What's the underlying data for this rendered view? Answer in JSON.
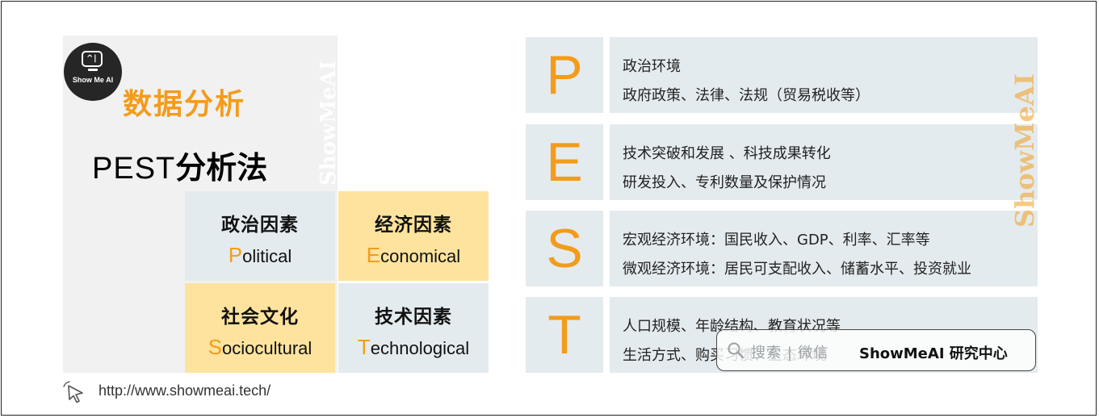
{
  "header": {
    "logo_text": "Show Me AI",
    "title": "数据分析",
    "subtitle_latin": "PEST",
    "subtitle_cn": "分析法"
  },
  "watermarks": {
    "left_vertical": "ShowMeAI",
    "right_vertical": "ShowMeAI"
  },
  "quadrants": [
    {
      "cn": "政治因素",
      "initial": "P",
      "rest": "olitical",
      "color": "#e4ebee"
    },
    {
      "cn": "经济因素",
      "initial": "E",
      "rest": "conomical",
      "color": "#fde39d"
    },
    {
      "cn": "社会文化",
      "initial": "S",
      "rest": "ociocultural",
      "color": "#fde39d"
    },
    {
      "cn": "技术因素",
      "initial": "T",
      "rest": "echnological",
      "color": "#e4ebee"
    }
  ],
  "pest_rows": [
    {
      "letter": "P",
      "line1": "政治环境",
      "line2": "政府政策、法律、法规（贸易税收等）"
    },
    {
      "letter": "E",
      "line1": "技术突破和发展 、科技成果转化",
      "line2": "研发投入、专利数量及保护情况"
    },
    {
      "letter": "S",
      "line1": "宏观经济环境：国民收入、GDP、利率、汇率等",
      "line2": "微观经济环境：居民可支配收入、储蓄水平、投资就业"
    },
    {
      "letter": "T",
      "line1": "人口规模、年龄结构、教育状况等",
      "line2": "生活方式、购买习惯、生态环境"
    }
  ],
  "badge": {
    "watermark_text": "搜索 | 微信",
    "brand": "ShowMeAI 研究中心"
  },
  "footer": {
    "url": "http://www.showmeai.tech/"
  },
  "colors": {
    "accent": "#f39c1b",
    "panel_blue": "#e4ebee",
    "panel_yellow": "#fde39d"
  }
}
